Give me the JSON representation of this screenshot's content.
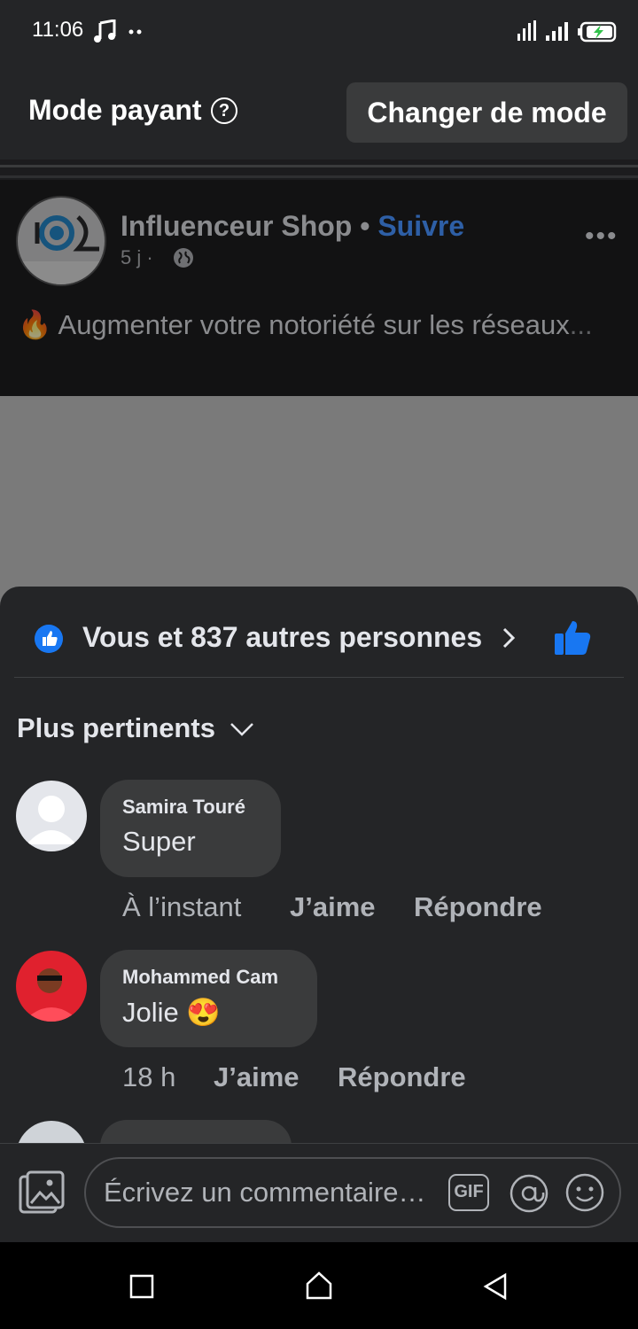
{
  "status_bar": {
    "time": "11:06"
  },
  "header": {
    "mode_title": "Mode payant",
    "change_mode_label": "Changer de mode"
  },
  "post": {
    "author": "Influenceur Shop",
    "separator": "•",
    "follow_label": "Suivre",
    "time": "5 j",
    "time_dot": "·",
    "emoji": "🔥",
    "text": "Augmenter votre notoriété sur les réseaux",
    "truncation": "..."
  },
  "reactions": {
    "summary": "Vous et 837 autres personnes"
  },
  "sort": {
    "label": "Plus pertinents"
  },
  "comments": [
    {
      "author": "Samira Touré",
      "text": "Super",
      "time": "À l’instant",
      "like_label": "J’aime",
      "reply_label": "Répondre"
    },
    {
      "author": "Mohammed Cam",
      "text": "Jolie",
      "emoji": "😍",
      "time": "18 h",
      "like_label": "J’aime",
      "reply_label": "Répondre"
    }
  ],
  "composer": {
    "placeholder": "Écrivez un commentaire…",
    "gif_label": "GIF"
  },
  "colors": {
    "accent": "#1877f2",
    "background": "#242527",
    "bubble": "#3a3b3c",
    "follow": "#2e5fa6"
  },
  "icons": [
    "music-note-icon",
    "more-dots-icon",
    "signal-icon",
    "battery-icon",
    "help-icon",
    "globe-icon",
    "more-icon",
    "like-badge-icon",
    "chevron-right-icon",
    "thumbs-up-icon",
    "chevron-down-icon",
    "photo-icon",
    "gif-icon",
    "at-icon",
    "emoji-icon",
    "nav-square-icon",
    "nav-home-icon",
    "nav-back-icon"
  ]
}
